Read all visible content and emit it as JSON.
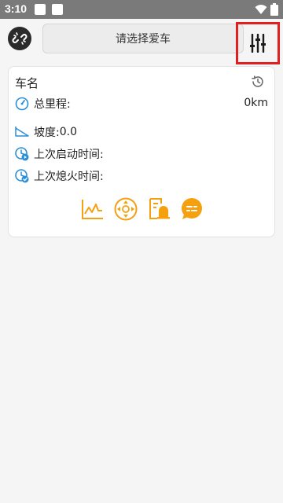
{
  "status_bar": {
    "time": "3:10"
  },
  "header": {
    "car_select_placeholder": "请选择爱车"
  },
  "card": {
    "car_name_label": "车名",
    "mileage_label": "总里程:",
    "mileage_value": "0km",
    "slope_label": "坡度:",
    "slope_value": "0.0",
    "last_start_label": "上次启动时间:",
    "last_stop_label": "上次熄火时间:"
  },
  "colors": {
    "accent_blue": "#2a8fd6",
    "accent_orange": "#f5a00f",
    "highlight_red": "#e02020"
  },
  "icons": {
    "link": "unlink-icon",
    "settings": "sliders-icon",
    "history": "history-icon",
    "mileage": "speedometer-icon",
    "slope": "slope-icon",
    "start": "clock-play-icon",
    "stop": "clock-check-icon",
    "actions": [
      "chart-line-icon",
      "direction-pad-icon",
      "alarm-icon",
      "message-icon"
    ]
  }
}
